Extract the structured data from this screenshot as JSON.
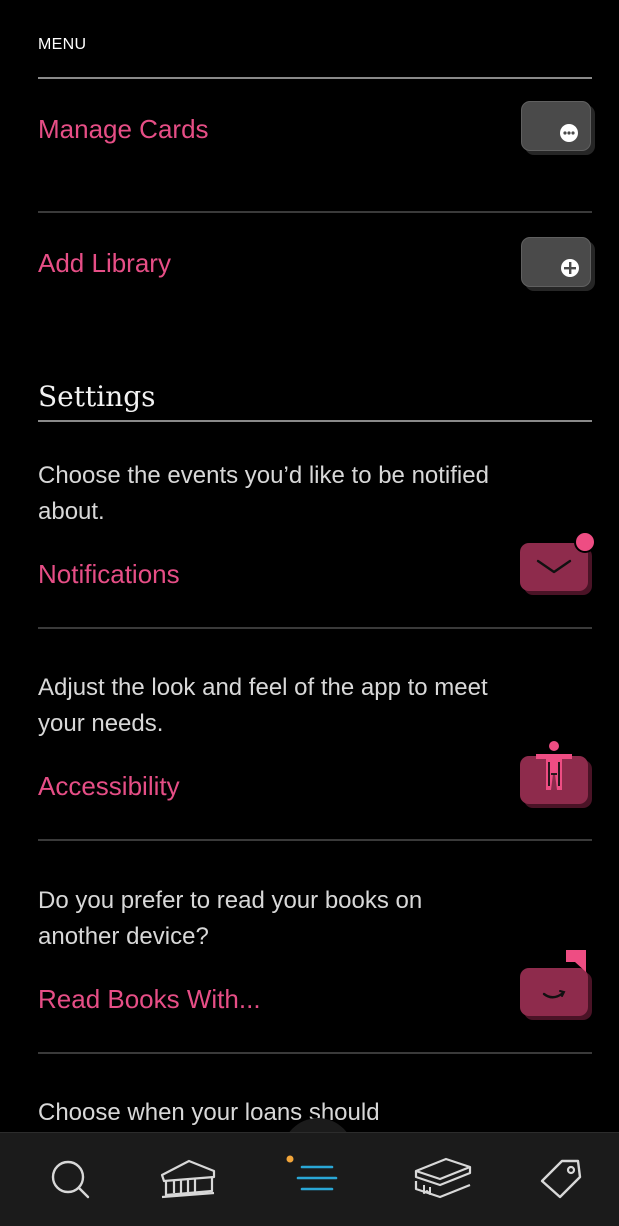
{
  "menu": {
    "label": "MENU"
  },
  "rows": {
    "manage_cards": "Manage Cards",
    "add_library": "Add Library"
  },
  "settings": {
    "heading": "Settings",
    "notifications": {
      "description": "Choose the events you’d like to be notified about.",
      "title": "Notifications"
    },
    "accessibility": {
      "description": "Adjust the look and feel of the app to meet your needs.",
      "title": "Accessibility"
    },
    "read_books_with": {
      "description": "Do you prefer to read your books on another device?",
      "title": "Read Books With..."
    },
    "loans": {
      "description": "Choose when your loans should"
    }
  },
  "tabbar": {
    "items": [
      {
        "name": "search",
        "icon": "search-icon"
      },
      {
        "name": "library",
        "icon": "library-building-icon"
      },
      {
        "name": "menu",
        "icon": "menu-lines-icon",
        "active": true
      },
      {
        "name": "shelf",
        "icon": "books-stack-icon"
      },
      {
        "name": "tags",
        "icon": "tag-icon"
      }
    ]
  },
  "colors": {
    "accent": "#e64e86",
    "background": "#000000",
    "tabbar": "#1b1b1b",
    "active_tab": "#2aa7d6",
    "notification_dot": "#ee4d83",
    "pink_tile": "#8e2b4c",
    "gray_tile": "#4a4a4a"
  }
}
